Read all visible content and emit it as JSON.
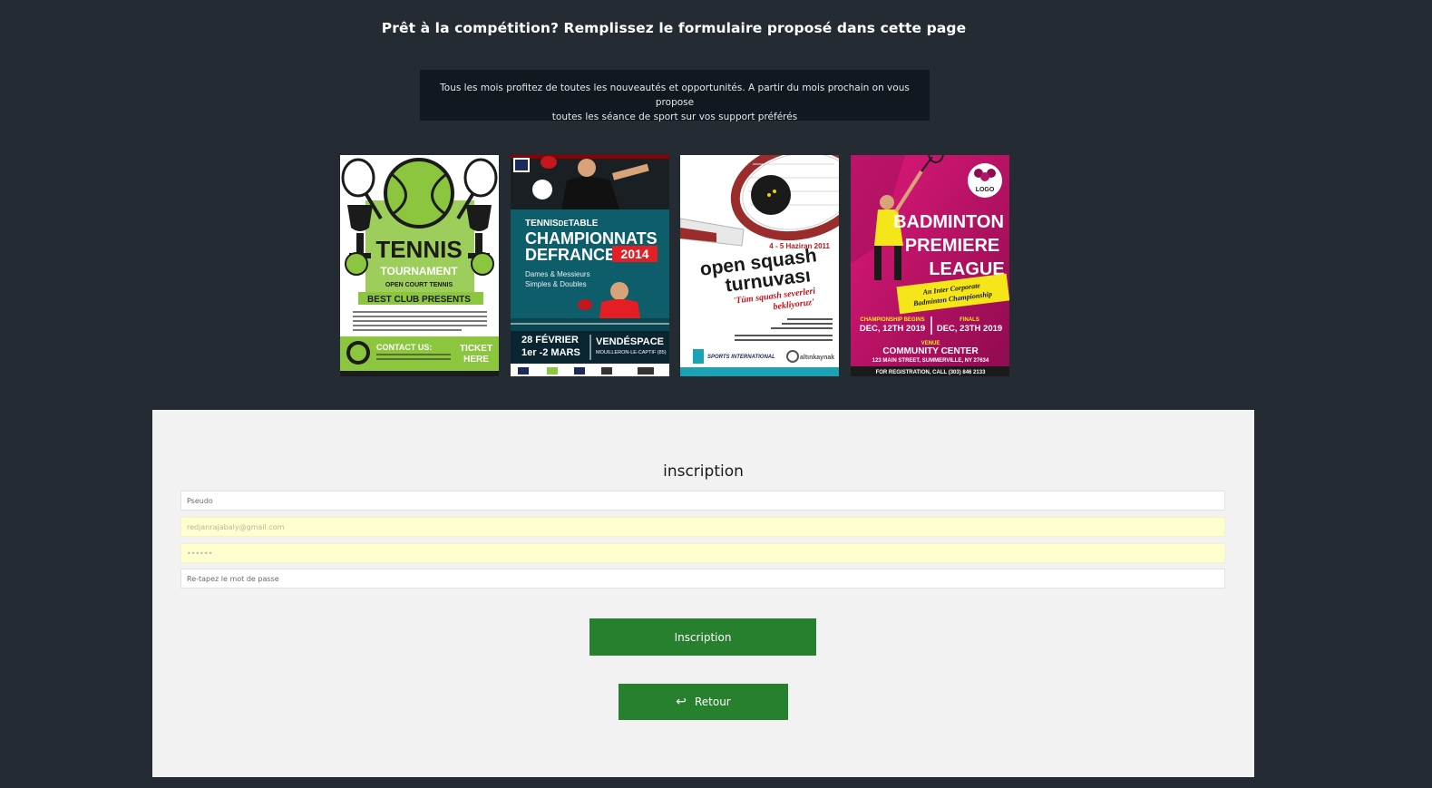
{
  "headline": "Prêt à la compétition? Remplissez le formulaire proposé dans cette page",
  "notice": {
    "line1": "Tous les mois profitez de toutes les nouveautés et opportunités. A partir du mois prochain on vous propose",
    "line2": "toutes les séance de sport sur vos support préférés"
  },
  "posters": {
    "tennis": {
      "title": "TENNIS",
      "subtitle": "TOURNAMENT",
      "tagline": "OPEN COURT TENNIS",
      "banner": "BEST CLUB PRESENTS",
      "contact": "CONTACT US:",
      "ticket_line1": "TICKET",
      "ticket_line2": "HERE",
      "colors": {
        "green": "#8cc63f",
        "dark": "#1b1b1b"
      }
    },
    "table_tennis": {
      "brand_part1": "TENNIS",
      "brand_part2": "DE",
      "brand_part3": "TABLE",
      "title_line1": "CHAMPIONNATS",
      "title_line2a": "DE",
      "title_line2b": "FRANCE",
      "year": "2014",
      "category_line1": "Dames & Messieurs",
      "category_line2": "Simples & Doubles",
      "dates_line1": "28 FÉVRIER",
      "dates_line2": "1er -2 MARS",
      "venue": "VENDÉSPACE",
      "city": "MOUILLERON-LE-CAPTIF (85)",
      "colors": {
        "teal": "#0d5d6b",
        "red": "#e31e24"
      }
    },
    "squash": {
      "dates": "4 - 5 Haziran 2011",
      "title_line1": "open squash",
      "title_line2": "turnuvası",
      "tagline_line1": "'Tüm squash severleri",
      "tagline_line2": "bekliyoruz'",
      "sponsor1": "SPORTS INTERNATIONAL",
      "sponsor2": "altınkaynak",
      "colors": {
        "red": "#c4161c",
        "cyan": "#1aa3b5"
      }
    },
    "badminton": {
      "logo": "LOGO",
      "title_line1": "BADMINTON",
      "title_line2": "PREMIERE",
      "title_line3": "LEAGUE",
      "ribbon_line1": "An Inter Corporate",
      "ribbon_line2": "Badminton Championship",
      "label_begins": "CHAMPIONSHIP BEGINS",
      "label_finals": "FINALS",
      "date_begins": "DEC, 12TH 2019",
      "date_finals": "DEC, 23TH 2019",
      "venue_label": "VENUE",
      "venue": "COMMUNITY CENTER",
      "address": "123 MAIN STREET, SUMMERVILLE, NY 27634",
      "registration": "FOR REGISTRATION, CALL (303) 846 2133",
      "colors": {
        "magenta": "#c0136e",
        "yellow": "#f5e61a"
      }
    }
  },
  "form": {
    "title": "inscription",
    "pseudo_placeholder": "Pseudo",
    "email_placeholder": "redjanrajabaly@gmail.com",
    "password_placeholder": "••••••",
    "confirm_placeholder": "Re-tapez le mot de passe",
    "submit_label": "Inscription",
    "back_icon": "↩",
    "back_label": "Retour"
  },
  "colors": {
    "page_background": "#252b33",
    "notice_background": "#111820",
    "form_background": "#f2f2f2",
    "button_green": "#26802e",
    "autofill_yellow": "#fefecf"
  }
}
